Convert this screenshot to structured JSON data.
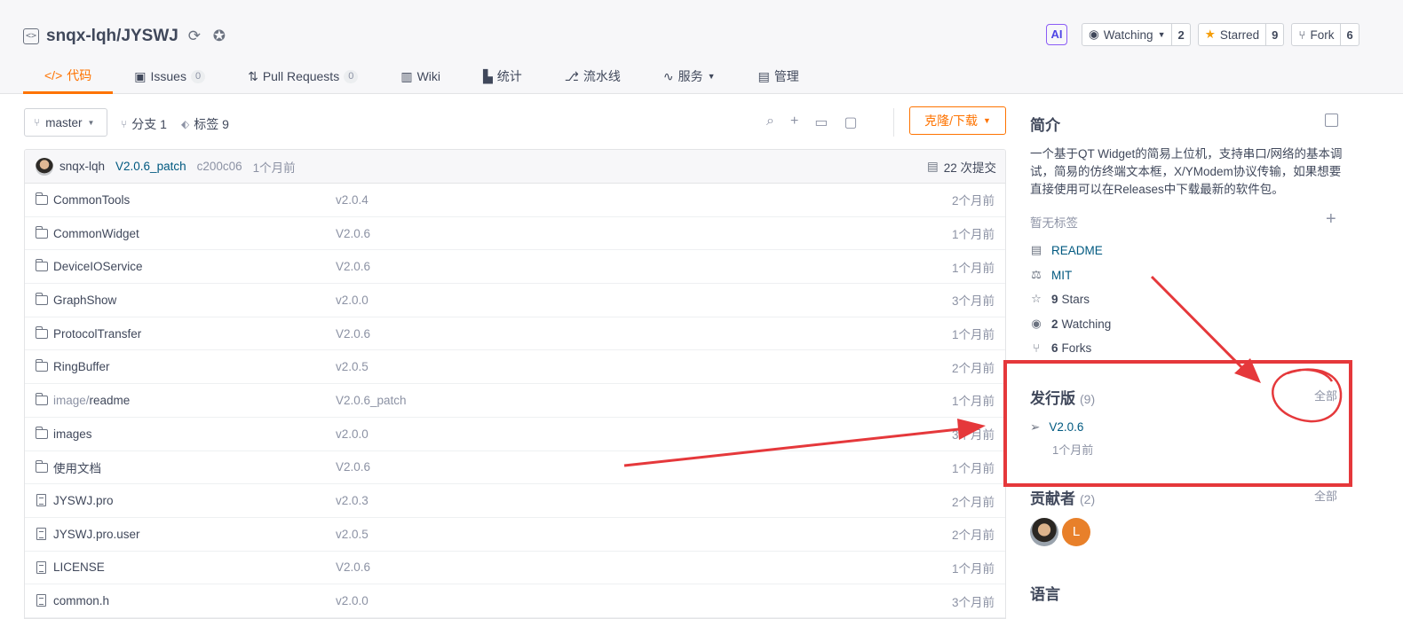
{
  "repo": {
    "path": "snqx-lqh/JYSWJ"
  },
  "top_actions": {
    "ai": "AI",
    "watching_label": "Watching",
    "watching_count": "2",
    "starred_label": "Starred",
    "starred_count": "9",
    "fork_label": "Fork",
    "fork_count": "6"
  },
  "nav": {
    "tabs": [
      {
        "label": "代码",
        "active": true
      },
      {
        "label": "Issues",
        "count": "0"
      },
      {
        "label": "Pull Requests",
        "count": "0"
      },
      {
        "label": "Wiki"
      },
      {
        "label": "统计"
      },
      {
        "label": "流水线"
      },
      {
        "label": "服务"
      },
      {
        "label": "管理"
      }
    ]
  },
  "toolbar": {
    "branch": "master",
    "branches": "分支 1",
    "tags": "标签 9",
    "clone_label": "克隆/下载"
  },
  "commit": {
    "author": "snqx-lqh",
    "message": "V2.0.6_patch",
    "sha": "c200c06",
    "time": "1个月前",
    "commits": "22 次提交"
  },
  "files": [
    {
      "name": "CommonTools",
      "type": "folder",
      "msg": "v2.0.4",
      "time": "2个月前"
    },
    {
      "name": "CommonWidget",
      "type": "folder",
      "msg": "V2.0.6",
      "time": "1个月前"
    },
    {
      "name": "DeviceIOService",
      "type": "folder",
      "msg": "V2.0.6",
      "time": "1个月前"
    },
    {
      "name": "GraphShow",
      "type": "folder",
      "msg": "v2.0.0",
      "time": "3个月前"
    },
    {
      "name": "ProtocolTransfer",
      "type": "folder",
      "msg": "V2.0.6",
      "time": "1个月前"
    },
    {
      "name": "RingBuffer",
      "type": "folder",
      "msg": "v2.0.5",
      "time": "2个月前"
    },
    {
      "name_dim": "image/",
      "name": "readme",
      "type": "folder",
      "msg": "V2.0.6_patch",
      "time": "1个月前"
    },
    {
      "name": "images",
      "type": "folder",
      "msg": "v2.0.0",
      "time": "3个月前"
    },
    {
      "name": "使用文档",
      "type": "folder",
      "msg": "V2.0.6",
      "time": "1个月前"
    },
    {
      "name": "JYSWJ.pro",
      "type": "file",
      "msg": "v2.0.3",
      "time": "2个月前"
    },
    {
      "name": "JYSWJ.pro.user",
      "type": "file",
      "msg": "v2.0.5",
      "time": "2个月前"
    },
    {
      "name": "LICENSE",
      "type": "file",
      "msg": "V2.0.6",
      "time": "1个月前"
    },
    {
      "name": "common.h",
      "type": "file",
      "msg": "v2.0.0",
      "time": "3个月前"
    }
  ],
  "sidebar": {
    "about_title": "简介",
    "description": "一个基于QT Widget的简易上位机，支持串口/网络的基本调试，简易的仿终端文本框，X/YModem协议传输，如果想要直接使用可以在Releases中下载最新的软件包。",
    "no_tags": "暂无标签",
    "readme": "README",
    "license": "MIT",
    "stars_num": "9",
    "stars_label": "Stars",
    "watching_num": "2",
    "watching_label": "Watching",
    "forks_num": "6",
    "forks_label": "Forks",
    "releases_title": "发行版",
    "releases_count": "(9)",
    "releases_all": "全部",
    "release_version": "V2.0.6",
    "release_time": "1个月前",
    "contributors_title": "贡献者",
    "contributors_count": "(2)",
    "contributors_all": "全部",
    "contributor_initial": "L",
    "language_title": "语言"
  },
  "colors": {
    "accent": "#fe7300",
    "link": "#005980",
    "annotation": "#e5383b"
  }
}
